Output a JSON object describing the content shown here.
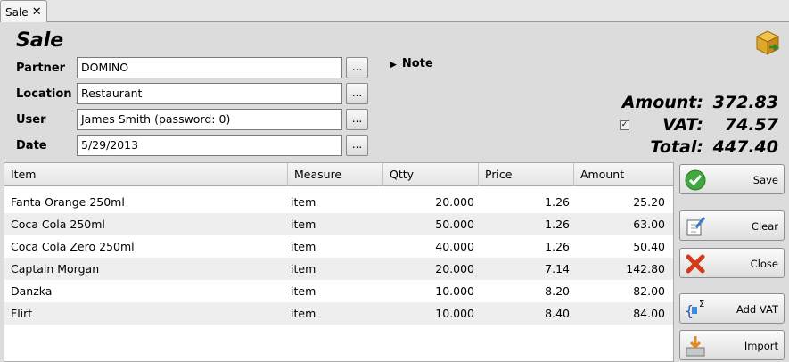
{
  "tab": {
    "label": "Sale",
    "close": "✕"
  },
  "form": {
    "title": "Sale",
    "partner": {
      "label": "Partner",
      "value": "DOMINO"
    },
    "location": {
      "label": "Location",
      "value": "Restaurant"
    },
    "user": {
      "label": "User",
      "value": "James Smith (password: 0)"
    },
    "date": {
      "label": "Date",
      "value": "5/29/2013"
    },
    "browse_label": "...",
    "note_label": "Note"
  },
  "totals": {
    "amount_label": "Amount:",
    "amount": "372.83",
    "vat_label": "VAT:",
    "vat": "74.57",
    "vat_checked": true,
    "total_label": "Total:",
    "total": "447.40"
  },
  "table": {
    "columns": [
      "Item",
      "Measure",
      "Qtty",
      "Price",
      "Amount"
    ],
    "rows": [
      {
        "item": "Fanta Orange 250ml",
        "measure": "item",
        "qtty": "20.000",
        "price": "1.26",
        "amount": "25.20"
      },
      {
        "item": "Coca Cola 250ml",
        "measure": "item",
        "qtty": "50.000",
        "price": "1.26",
        "amount": "63.00"
      },
      {
        "item": "Coca Cola Zero 250ml",
        "measure": "item",
        "qtty": "40.000",
        "price": "1.26",
        "amount": "50.40"
      },
      {
        "item": "Captain Morgan",
        "measure": "item",
        "qtty": "20.000",
        "price": "7.14",
        "amount": "142.80"
      },
      {
        "item": "Danzka",
        "measure": "item",
        "qtty": "10.000",
        "price": "8.20",
        "amount": "82.00"
      },
      {
        "item": "Flirt",
        "measure": "item",
        "qtty": "10.000",
        "price": "8.40",
        "amount": "84.00"
      }
    ]
  },
  "actions": {
    "save": "Save",
    "clear": "Clear",
    "close": "Close",
    "add_vat": "Add VAT",
    "import": "Import"
  },
  "colors": {
    "save_green": "#3fa83f",
    "close_red": "#d23a1a",
    "import_orange": "#e08a1e"
  }
}
